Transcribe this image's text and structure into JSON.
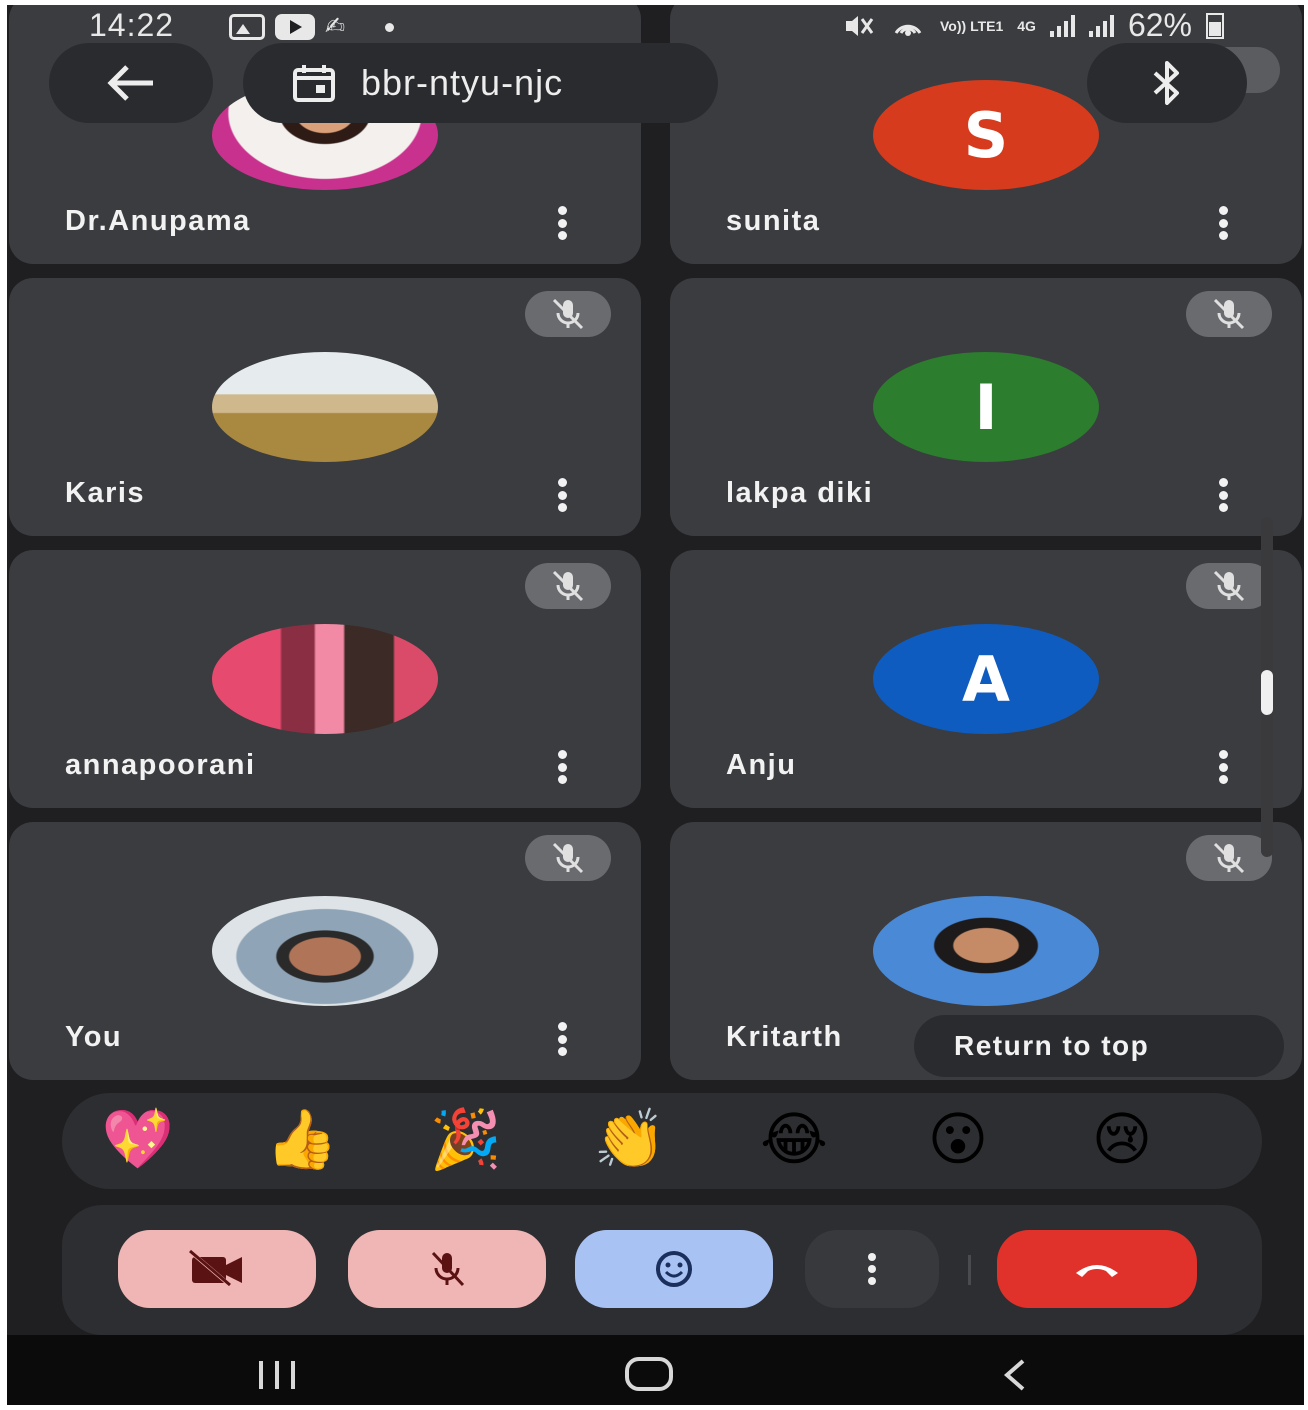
{
  "status_bar": {
    "time": "14:22",
    "left_icons": [
      "gallery-icon",
      "youtube-icon",
      "stylus-icon",
      "notification-dot-icon"
    ],
    "network_labels": {
      "volte": "Vo)) LTE1",
      "data": "4G"
    },
    "battery": "62%"
  },
  "header": {
    "meeting_code": "bbr-ntyu-njc"
  },
  "participants": [
    {
      "name": "Dr.Anupama",
      "avatar": "photo",
      "muted": false
    },
    {
      "name": "sunita",
      "avatar": "letter",
      "letter": "S",
      "color": "#d63b1e",
      "muted": true
    },
    {
      "name": "Karis",
      "avatar": "photo",
      "muted": true
    },
    {
      "name": "lakpa diki",
      "avatar": "letter",
      "letter": "I",
      "color": "#2c7d2e",
      "muted": true
    },
    {
      "name": "annapoorani",
      "avatar": "photo",
      "muted": true
    },
    {
      "name": "Anju",
      "avatar": "letter",
      "letter": "A",
      "color": "#0f5cc0",
      "muted": true
    },
    {
      "name": "You",
      "avatar": "photo",
      "muted": true
    },
    {
      "name": "Kritarth",
      "avatar": "photo",
      "muted": true
    }
  ],
  "return_to_top": "Return to top",
  "reactions": [
    "💖",
    "👍",
    "🎉",
    "👏",
    "😂",
    "😮",
    "😢"
  ],
  "controls": {
    "camera": "camera-off-icon",
    "microphone": "mic-off-icon",
    "reactions": "smile-icon",
    "more": "more-vert-icon",
    "end_call": "end-call-icon"
  },
  "colors": {
    "background": "#1f1f21",
    "tile": "#3b3c3f",
    "end_call": "#e0322b",
    "muted_control": "#f0b6b5",
    "reaction_control": "#a9c2f4"
  }
}
